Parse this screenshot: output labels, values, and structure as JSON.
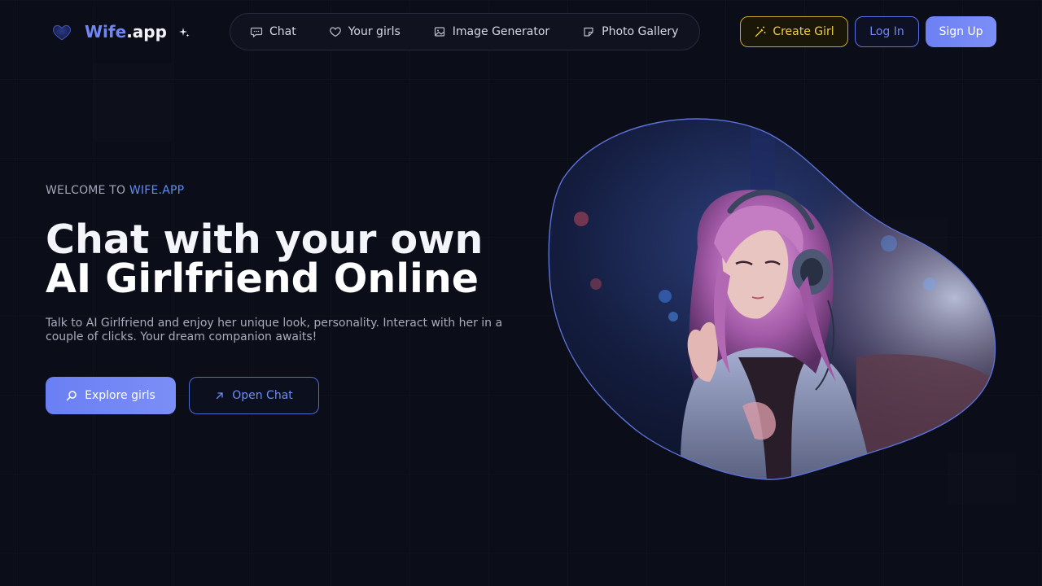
{
  "brand": {
    "name_accent": "Wife",
    "name_rest": ".app"
  },
  "nav": [
    {
      "label": "Chat",
      "icon": "chat-bubble-icon"
    },
    {
      "label": "Your girls",
      "icon": "heart-icon"
    },
    {
      "label": "Image Generator",
      "icon": "image-icon"
    },
    {
      "label": "Photo Gallery",
      "icon": "sticker-icon"
    }
  ],
  "actions": {
    "create_label": "Create Girl",
    "login_label": "Log In",
    "signup_label": "Sign Up"
  },
  "hero": {
    "eyebrow_prefix": "WELCOME TO ",
    "eyebrow_highlight": "WIFE.APP",
    "title_line1": "Chat with your own",
    "title_line2": "AI Girlfriend Online",
    "description": "Talk to AI Girlfriend and enjoy her unique look, personality. Interact with her in a couple of clicks. Your dream companion awaits!",
    "explore_label": "Explore girls",
    "open_chat_label": "Open Chat"
  },
  "colors": {
    "background": "#0b0d18",
    "accent": "#6f86f3",
    "create_gold": "#f1cd45",
    "eyebrow_highlight": "#5f8ef0"
  }
}
